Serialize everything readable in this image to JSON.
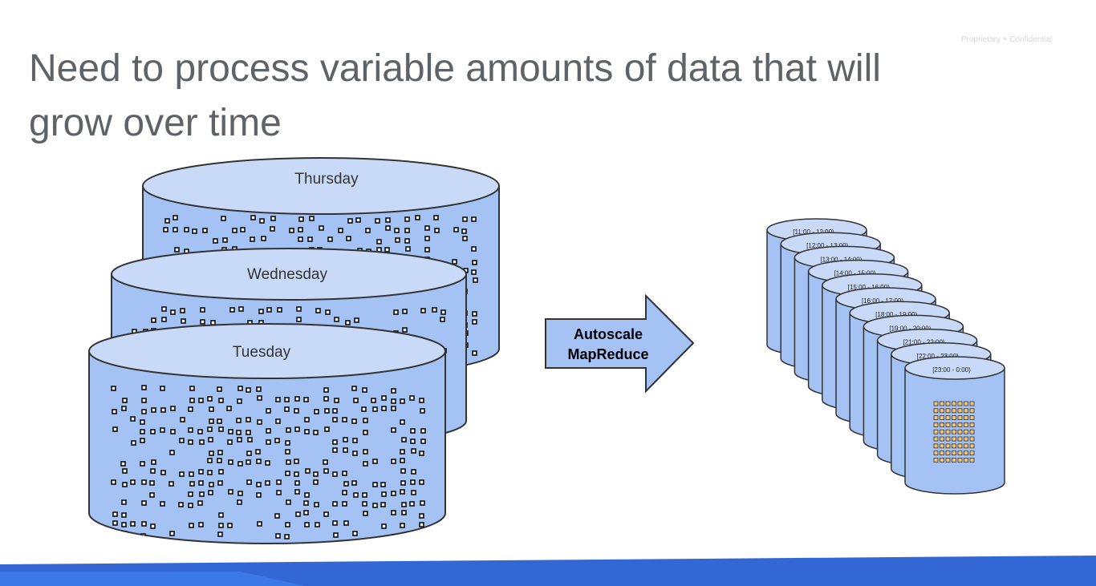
{
  "slide": {
    "confidential": "Proprietary + Confidential",
    "title_lines": [
      "Need to process variable amounts of data that will",
      "grow over time"
    ]
  },
  "diagram": {
    "daily_datasets": [
      "Thursday",
      "Wednesday",
      "Tuesday"
    ],
    "process_arrow": {
      "line1": "Autoscale",
      "line2": "MapReduce"
    },
    "hourly_partitions": [
      "[11:00 - 12:00)",
      "[12:00 - 13:00)",
      "[13:00 - 14:00)",
      "[14:00 - 15:00)",
      "[15:00 - 16:00)",
      "[16:00 - 17:00)",
      "[18:00 - 19:00)",
      "[19:00 - 20:00)",
      "[21:00 - 22:00)",
      "[22:00 - 23:00)",
      "[23:00 - 0:00)"
    ]
  },
  "colors": {
    "cylinder_body": "#a4c2f4",
    "cylinder_top": "#c9daf8",
    "outline": "#333333",
    "title_text": "#5f6368",
    "bottom_band": "#3367d6",
    "grid_dot": "#f6c26b"
  }
}
